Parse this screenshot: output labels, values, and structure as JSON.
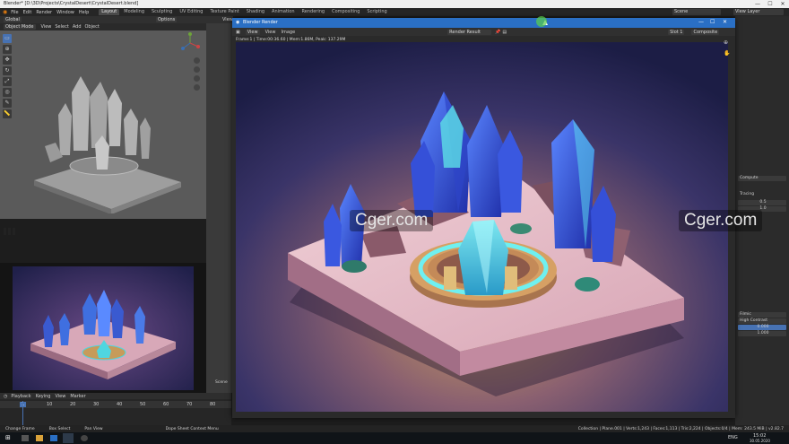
{
  "titlebar": {
    "title": "Blender* [D:\\3D\\Projects\\CrystalDesert\\CrystalDesert.blend]",
    "min": "—",
    "max": "☐",
    "close": "✕"
  },
  "menubar": {
    "menus": [
      "File",
      "Edit",
      "Render",
      "Window",
      "Help"
    ],
    "workspaces": [
      "Layout",
      "Modeling",
      "Sculpting",
      "UV Editing",
      "Texture Paint",
      "Shading",
      "Animation",
      "Rendering",
      "Compositing",
      "Scripting"
    ],
    "active_workspace": "Layout",
    "scene_label": "Scene",
    "view_layer_label": "View Layer"
  },
  "viewport": {
    "mode": "Object Mode",
    "menus": [
      "View",
      "Select",
      "Add",
      "Object"
    ],
    "transform": "Global",
    "options": "Options",
    "view_label": "View"
  },
  "render_window": {
    "title": "Blender Render",
    "menus": [
      "View",
      "View",
      "Image"
    ],
    "image_name": "Render Result",
    "slot": "Slot 1",
    "layer": "Composite",
    "info": "Frame:1 | Time:00:36.60 | Mem:1.86M, Peak: 137.29M"
  },
  "right_panel": {
    "rows": [
      "Compute",
      "Tracing",
      "0.5",
      "1.0",
      "Filmic",
      "High Contrast",
      "0.000",
      "1.000"
    ]
  },
  "timeline": {
    "menus": [
      "Playback",
      "Keying",
      "View",
      "Marker"
    ],
    "frames": [
      "1",
      "10",
      "20",
      "30",
      "40",
      "50",
      "60",
      "70",
      "80"
    ],
    "current_frame": "1"
  },
  "statusbar": {
    "left": [
      "Change Frame",
      "Box Select",
      "Pan View"
    ],
    "center": "Dope Sheet Context Menu",
    "right": "Collection | Plane.001 | Verts:1,243 | Faces:1,113 | Tris:2,224 | Objects:0/4 | Mem: 243.5 MiB | v2.82.7"
  },
  "taskbar": {
    "lang": "ENG",
    "time": "15:02",
    "date": "30.05.2020"
  },
  "viewport_scene_label": "Scene",
  "watermarks": [
    "Cger.com",
    "Cger.com"
  ],
  "colors": {
    "accent": "#4772b3",
    "render_title": "#2a6fc4"
  }
}
